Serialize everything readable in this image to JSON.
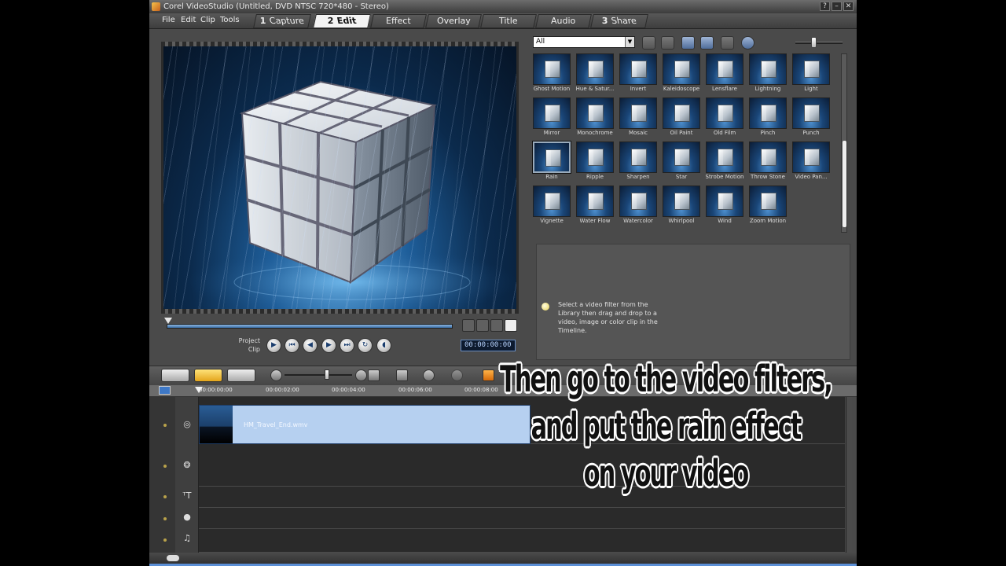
{
  "window": {
    "title": "Corel VideoStudio (Untitled, DVD NTSC 720*480 - Stereo)",
    "controls": [
      "?",
      "–",
      "✕"
    ]
  },
  "menu": [
    "File",
    "Edit",
    "Clip",
    "Tools"
  ],
  "steps": [
    {
      "num": "1",
      "label": "Capture",
      "active": false
    },
    {
      "num": "2",
      "label": "Edit",
      "active": true
    },
    {
      "num": "",
      "label": "Effect",
      "active": false
    },
    {
      "num": "",
      "label": "Overlay",
      "active": false
    },
    {
      "num": "",
      "label": "Title",
      "active": false
    },
    {
      "num": "",
      "label": "Audio",
      "active": false
    },
    {
      "num": "3",
      "label": "Share",
      "active": false
    }
  ],
  "preview": {
    "mode_project": "Project",
    "mode_clip": "Clip",
    "timecode": "00:00:00:00",
    "controls": [
      "play-icon",
      "jump-start-icon",
      "step-back-icon",
      "step-forward-icon",
      "jump-end-icon",
      "repeat-icon",
      "volume-icon"
    ]
  },
  "library": {
    "category": "All",
    "filters": [
      "Ghost Motion",
      "Hue & Satur...",
      "Invert",
      "Kaleidoscope",
      "Lensflare",
      "Lightning",
      "Light",
      "Mirror",
      "Monochrome",
      "Mosaic",
      "Oil Paint",
      "Old Film",
      "Pinch",
      "Punch",
      "Rain",
      "Ripple",
      "Sharpen",
      "Star",
      "Strobe Motion",
      "Throw Stone",
      "Video Pan...",
      "Vignette",
      "Water Flow",
      "Watercolor",
      "Whirlpool",
      "Wind",
      "Zoom Motion"
    ],
    "selected": "Rain",
    "hint": "Select a video filter from the Library then drag and drop to a video, image or color clip in the Timeline."
  },
  "timeline": {
    "ruler": [
      "00:00:00:00",
      "00:00:02:00",
      "00:00:04:00",
      "00:00:06:00",
      "00:00:08:00"
    ],
    "clip_name": "HM_Travel_End.wmv",
    "tracks": [
      "video-track-icon",
      "overlay-track-icon",
      "title-track-icon",
      "voice-track-icon",
      "music-track-icon"
    ]
  },
  "caption": {
    "line1": "Then go to the video filters,",
    "line2": "and put the rain effect",
    "line3": "on your video"
  }
}
